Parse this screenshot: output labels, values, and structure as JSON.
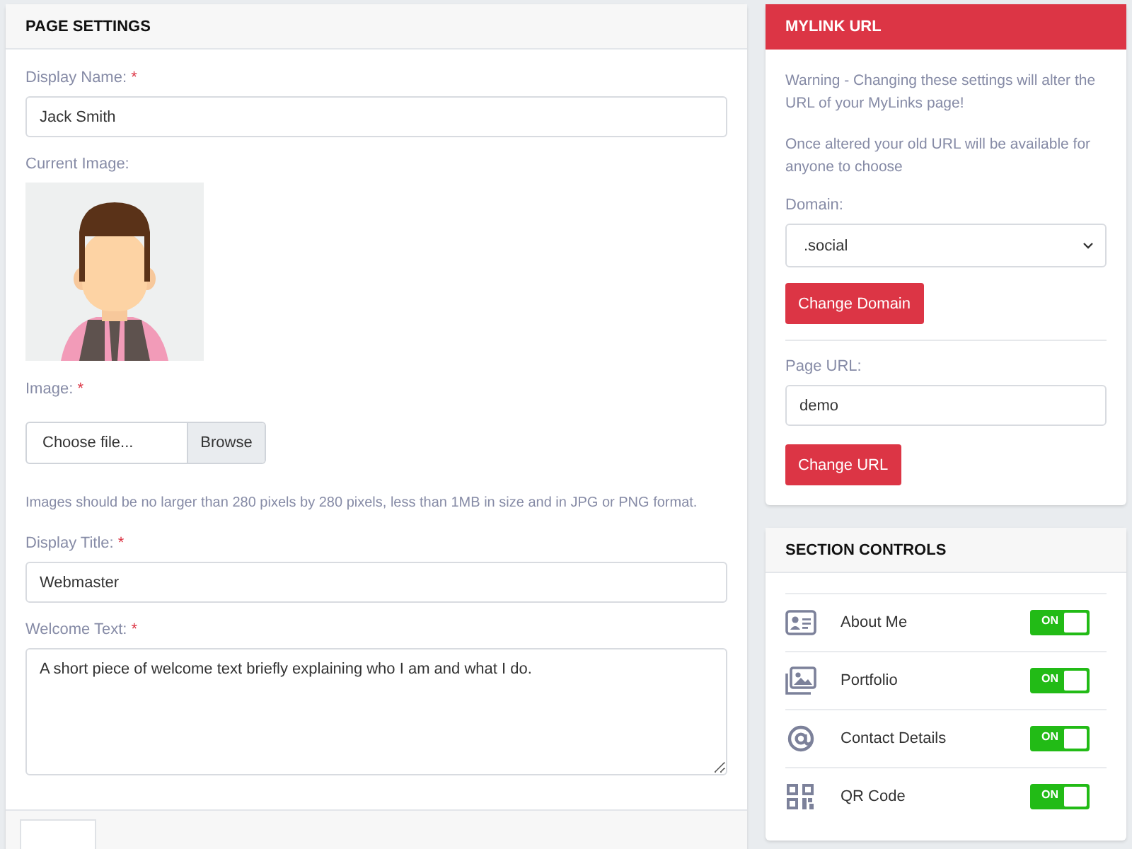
{
  "page_settings": {
    "title": "PAGE SETTINGS",
    "display_name": {
      "label": "Display Name:",
      "marker": "*",
      "value": "Jack Smith"
    },
    "current_image": {
      "label": "Current Image:",
      "kind": "picture"
    },
    "image": {
      "label": "Image:",
      "marker": "*",
      "placeholder": "Choose file...",
      "button": "Browse"
    },
    "help": "Images should be no larger than 280 pixels by 280 pixels, less than 1MB in size and in JPG or PNG format.",
    "display_title": {
      "label": "Display Title:",
      "marker": "*",
      "value": "Webmaster"
    },
    "welcome_text": {
      "label": "Welcome Text:",
      "marker": "*",
      "value": "A short piece of welcome text briefly explaining who I am and what I do."
    }
  },
  "mylink_url": {
    "title": "MYLINK URL",
    "warnings": [
      "Warning - Changing these settings will alter the URL of your MyLinks page!",
      "Once altered your old URL will be available for anyone to choose"
    ],
    "domain": {
      "label": "Domain:",
      "value": ".social",
      "button": "Change Domain"
    },
    "page_url": {
      "label": "Page URL:",
      "value": "demo",
      "button": "Change URL"
    }
  },
  "section_controls": {
    "title": "SECTION CONTROLS",
    "items": [
      {
        "label": "About Me",
        "on": true,
        "toggle_text": "ON"
      },
      {
        "label": "Portfolio",
        "on": true,
        "toggle_text": "ON"
      },
      {
        "label": "Contact Details",
        "on": true,
        "toggle_text": "ON"
      },
      {
        "label": "QR Code",
        "on": true,
        "toggle_text": "ON"
      }
    ]
  }
}
